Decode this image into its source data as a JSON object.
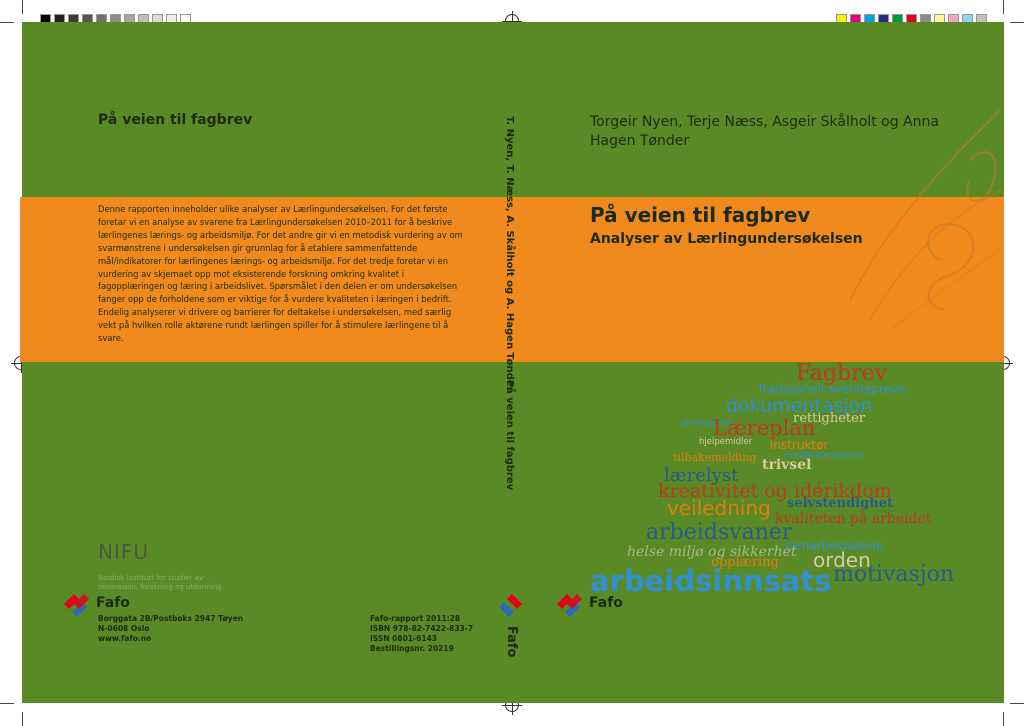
{
  "colors": {
    "background": "#5a8a26",
    "band": "#f08a1c",
    "text_dark": "#1d2a12",
    "cloud_red": "#c0391b",
    "cloud_blue": "#2f8fd0",
    "cloud_orange": "#e07a14",
    "cloud_tan": "#d9c9a0",
    "cloud_navy": "#2a5a8a"
  },
  "back_cover": {
    "title": "På veien til fagbrev",
    "abstract": "Denne rapporten inneholder ulike analyser av Lærlingundersøkelsen. For det første foretar vi en analyse av svarene fra Lærlingundersøkelsen 2010–2011 for å beskrive lærlingenes lærings- og arbeidsmiljø. For det andre gir vi en metodisk vurdering av om svarmønstrene i undersøkelsen gir grunnlag for å etablere sammenfattende mål/indikatorer for lærlingenes lærings- og arbeidsmiljø. For det tredje foretar vi en vurdering av skjemaet opp mot eksisterende forskning omkring kvalitet i fagopplæringen og læring i arbeidslivet. Spørsmålet i den delen er om undersøkelsen fanger opp de forholdene som er viktige for å vurdere kvaliteten i læringen i bedrift. Endelig analyserer vi drivere og barrierer for deltakelse i undersøkelsen, med særlig vekt på hvilken rolle aktørene rundt lærlingen spiller for å stimulere lærlingene til å svare.",
    "nifu": "NIFU",
    "nifu_sub": [
      "Nordisk institutt for studier av",
      "innovasjon, forskning og utdanning"
    ],
    "fafo": "Fafo",
    "address": [
      "Borggata 2B/Postboks 2947 Tøyen",
      "N-0608 Oslo",
      "www.fafo.no"
    ],
    "meta": [
      "Fafo-rapport 2011:28",
      "ISBN 978-82-7422-833-7",
      "ISSN 0801-6143",
      "Bestillingsnr. 20219"
    ]
  },
  "spine": {
    "authors": "T. Nyen, T. Næss, A. Skålholt og A. Hagen Tønder",
    "title": "På veien til fagbrev",
    "fafo": "Fafo"
  },
  "front_cover": {
    "authors": "Torgeir Nyen, Terje Næss, Asgeir Skålholt og Anna Hagen Tønder",
    "title": "På veien til fagbrev",
    "subtitle": "Analyser av Lærlingundersøkelsen",
    "fafo": "Fafo",
    "word_cloud": [
      "Fagbrev",
      "Tradisjonell svenneprøve",
      "dokumentasjon",
      "rettigheter",
      "planlegging",
      "Læreplan",
      "hjelpemidler",
      "instruktør",
      "medbestemmelse",
      "tilbakemelding",
      "trivsel",
      "lærelyst",
      "kreativitet og idérikdom",
      "veiledning",
      "selvstendighet",
      "kvaliteten på arbeidet",
      "arbeidsvaner",
      "samarbeidsevne",
      "helse miljø og sikkerhet",
      "orden",
      "opplæring",
      "arbeidsinnsats",
      "motivasjon"
    ]
  }
}
